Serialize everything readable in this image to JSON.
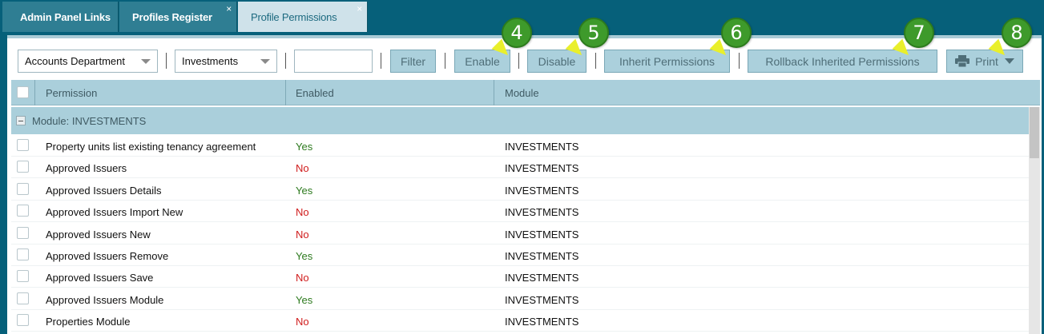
{
  "tabs": [
    {
      "label": "Admin Panel Links",
      "closable": false,
      "active": false
    },
    {
      "label": "Profiles Register",
      "closable": true,
      "active": false
    },
    {
      "label": "Profile Permissions",
      "closable": true,
      "active": true
    }
  ],
  "tab_close_glyph": "×",
  "toolbar": {
    "department_select": "Accounts Department",
    "module_select": "Investments",
    "filter_input_value": "",
    "filter_label": "Filter",
    "enable_label": "Enable",
    "disable_label": "Disable",
    "inherit_label": "Inherit Permissions",
    "rollback_label": "Rollback Inherited Permissions",
    "print_label": "Print"
  },
  "callouts": [
    "4",
    "5",
    "6",
    "7",
    "8"
  ],
  "grid": {
    "columns": [
      "Permission",
      "Enabled",
      "Module"
    ],
    "group_label": "Module: INVESTMENTS",
    "rows": [
      {
        "permission": "Property units list existing tenancy agreement",
        "enabled": "Yes",
        "module": "INVESTMENTS"
      },
      {
        "permission": "Approved Issuers",
        "enabled": "No",
        "module": "INVESTMENTS"
      },
      {
        "permission": "Approved Issuers Details",
        "enabled": "Yes",
        "module": "INVESTMENTS"
      },
      {
        "permission": "Approved Issuers Import New",
        "enabled": "No",
        "module": "INVESTMENTS"
      },
      {
        "permission": "Approved Issuers New",
        "enabled": "No",
        "module": "INVESTMENTS"
      },
      {
        "permission": "Approved Issuers Remove",
        "enabled": "Yes",
        "module": "INVESTMENTS"
      },
      {
        "permission": "Approved Issuers Save",
        "enabled": "No",
        "module": "INVESTMENTS"
      },
      {
        "permission": "Approved Issuers Module",
        "enabled": "Yes",
        "module": "INVESTMENTS"
      },
      {
        "permission": "Properties Module",
        "enabled": "No",
        "module": "INVESTMENTS"
      }
    ]
  },
  "colors": {
    "frame": "#06607a",
    "header": "#aacfdb",
    "yes": "#2d7a1e",
    "no": "#d01c1c",
    "callout": "#3e9a2b",
    "pointer": "#e9ef2b"
  },
  "icons": [
    "close-icon",
    "caret-down-icon",
    "printer-icon",
    "collapse-minus-icon"
  ]
}
